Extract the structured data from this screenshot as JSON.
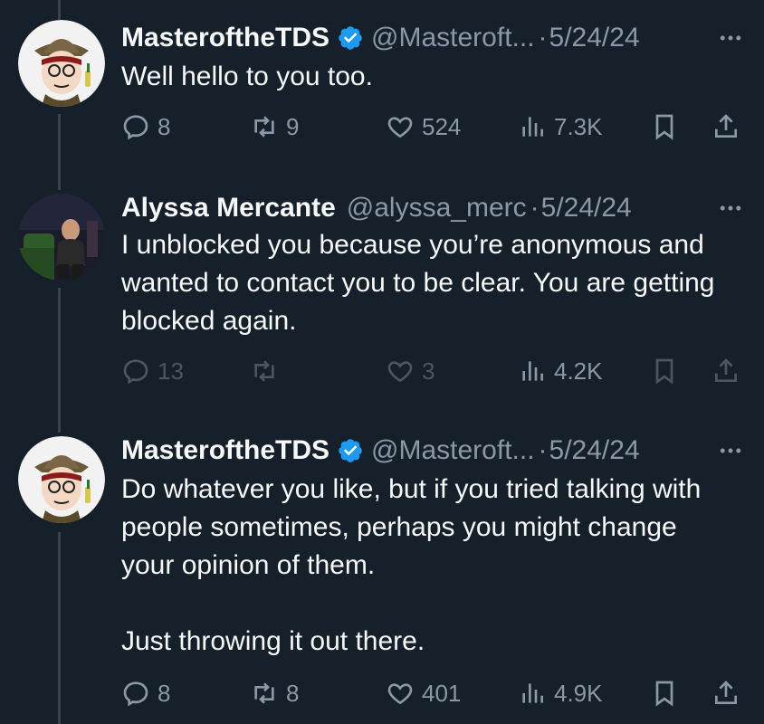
{
  "tweets": [
    {
      "author_name": "MasteroftheTDS",
      "verified": true,
      "handle": "@Masteroft...",
      "separator": "·",
      "date": "5/24/24",
      "avatar": "cartoon-man-hat-avatar",
      "text_paragraphs": [
        "Well hello to you too."
      ],
      "replies": "8",
      "retweets": "9",
      "likes": "524",
      "views": "7.3K"
    },
    {
      "author_name": "Alyssa Mercante",
      "verified": false,
      "handle": "@alyssa_merc",
      "separator": "·",
      "date": "5/24/24",
      "avatar": "photo-avatar",
      "text_paragraphs": [
        "I unblocked you because you’re anonymous and wanted to contact you to be clear. You are getting blocked again."
      ],
      "replies": "13",
      "retweets": "",
      "likes": "3",
      "views": "4.2K"
    },
    {
      "author_name": "MasteroftheTDS",
      "verified": true,
      "handle": "@Masteroft...",
      "separator": "·",
      "date": "5/24/24",
      "avatar": "cartoon-man-hat-avatar",
      "text_paragraphs": [
        "Do whatever you like, but if you tried talking with people sometimes, perhaps you might change your opinion of them.",
        "Just throwing it out there."
      ],
      "replies": "8",
      "retweets": "8",
      "likes": "401",
      "views": "4.9K"
    }
  ],
  "colors": {
    "background": "#15202b",
    "text": "#f7f9f9",
    "secondary": "#8b98a5",
    "verified": "#1d9bf0",
    "thread_line": "#38444d"
  },
  "icons": [
    "reply-icon",
    "retweet-icon",
    "like-icon",
    "views-icon",
    "bookmark-icon",
    "share-icon",
    "more-icon",
    "verified-badge-icon"
  ]
}
